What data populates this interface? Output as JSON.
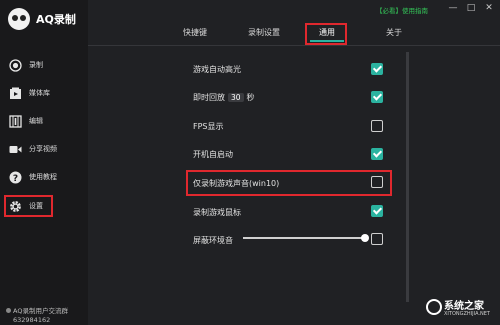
{
  "app": {
    "name": "AQ录制"
  },
  "topbar": {
    "notice": "【必看】使用指南",
    "minimize": "—",
    "maximize": "□",
    "close": "✕"
  },
  "sidebar": {
    "items": [
      {
        "label": "录制",
        "icon": "record-icon"
      },
      {
        "label": "媒体库",
        "icon": "media-library-icon"
      },
      {
        "label": "编辑",
        "icon": "edit-icon"
      },
      {
        "label": "分享视频",
        "icon": "video-icon"
      },
      {
        "label": "使用教程",
        "icon": "help-icon"
      },
      {
        "label": "设置",
        "icon": "gear-icon",
        "active": true
      }
    ],
    "user": {
      "line1": "AQ录制用户交流群",
      "line2": "632984162"
    }
  },
  "tabs": [
    {
      "label": "快捷键"
    },
    {
      "label": "录制设置"
    },
    {
      "label": "通用",
      "active": true
    },
    {
      "label": "关于"
    }
  ],
  "settings": [
    {
      "label": "游戏自动高光",
      "checked": true
    },
    {
      "label_pre": "即时回放",
      "value": "30",
      "label_post": "秒",
      "checked": true
    },
    {
      "label": "FPS显示",
      "checked": false
    },
    {
      "label": "开机自启动",
      "checked": true
    },
    {
      "label": "仅录制游戏声音(win10)",
      "checked": false
    },
    {
      "label": "录制游戏鼠标",
      "checked": true
    },
    {
      "label": "屏蔽环境音",
      "checked": false,
      "slider_level": 1.0
    }
  ],
  "watermark": {
    "main": "系统之家",
    "sub": "XITONGZHIJIA.NET"
  },
  "colors": {
    "accent": "#2bb3a0",
    "highlight": "#e0282e",
    "notice": "#34c759"
  }
}
